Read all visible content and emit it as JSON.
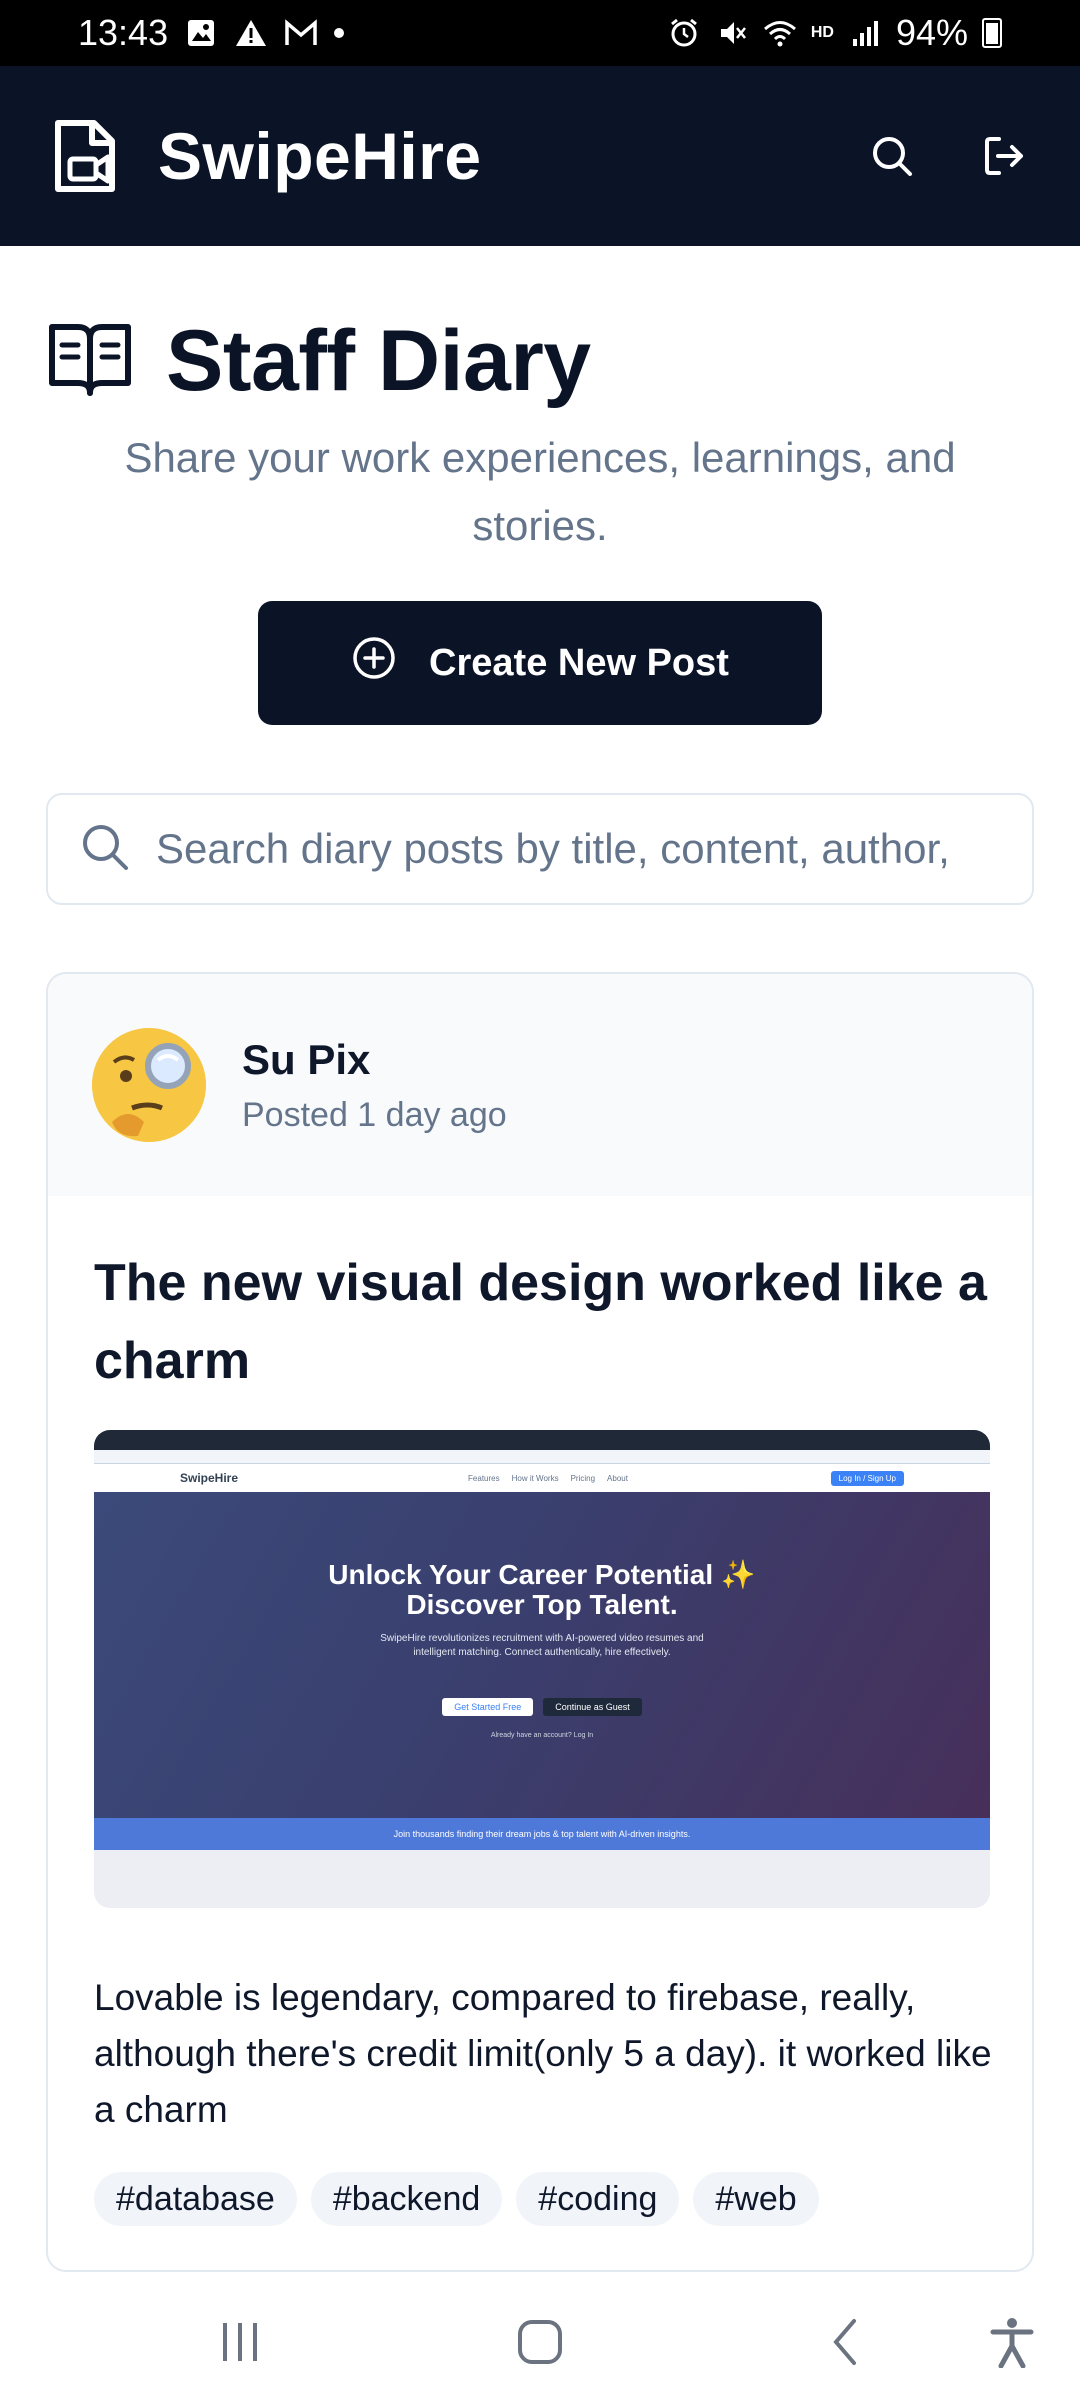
{
  "status_bar": {
    "time": "13:43",
    "network": "HD",
    "battery": "94%"
  },
  "header": {
    "app_name": "SwipeHire",
    "icons": [
      "logo-icon",
      "search-icon",
      "logout-icon"
    ],
    "background": "#0b1427"
  },
  "page": {
    "title": "Staff Diary",
    "subtitle": "Share your work experiences, learnings, and stories.",
    "create_button": "Create New Post",
    "search_placeholder": "Search diary posts by title, content, author,"
  },
  "post": {
    "author": "Su Pix",
    "time": "Posted 1 day ago",
    "title": "The new visual design worked like a charm",
    "body": "Lovable is legendary, compared to firebase, really, although there's credit limit(only 5 a day). it worked like a charm",
    "tags": [
      "#database",
      "#backend",
      "#coding",
      "#web"
    ],
    "image": {
      "brand": "SwipeHire",
      "nav_links": [
        "Features",
        "How it Works",
        "Pricing",
        "About"
      ],
      "login": "Log In / Sign Up",
      "headline_1": "Unlock Your Career Potential ✨",
      "headline_2": "Discover Top Talent.",
      "description": "SwipeHire revolutionizes recruitment with AI-powered video resumes and intelligent matching. Connect authentically, hire effectively.",
      "button_primary": "Get Started Free",
      "button_secondary": "Continue as Guest",
      "small_text": "Already have an account? Log In",
      "banner": "Join thousands finding their dream jobs & top talent with AI-driven insights."
    }
  },
  "colors": {
    "accent": "#0b1427",
    "muted_text": "#64748b",
    "border": "#e2e8f0",
    "tag_bg": "#f1f5f9"
  }
}
